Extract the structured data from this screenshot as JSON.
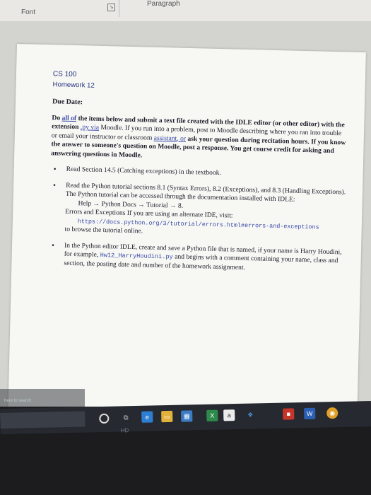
{
  "ribbon": {
    "font_group": "Font",
    "paragraph_group": "Paragraph"
  },
  "doc": {
    "course": "CS 100",
    "homework": "Homework 12",
    "due_label": "Due Date:",
    "intro": {
      "p1": "Do ",
      "p1_link": "all of",
      "p2": " the items below and ",
      "p2_bold": "submit",
      "p3": " a text file created with the IDLE editor (or other editor) with the extension ",
      "p3_ext": ".py via",
      "p4": " Moodle. If you run into a problem, post to Moodle describing where you ran into trouble or email your instructor or classroom ",
      "p4_link": "assistant, or",
      "p5": " ask your question during recitation hours. If you know the answer to someone's question on Moodle, post a response. You get course credit for asking and answering questions in Moodle."
    },
    "bullets": {
      "b1": "Read Section 14.5 (Catching exceptions) in the textbook.",
      "b2_main": "Read the Python tutorial sections 8.1 (Syntax Errors), 8.2 (Exceptions), and 8.3 (Handling Exceptions). The Python tutorial can be accessed through the documentation installed with IDLE:",
      "b2_path": "Help → Python Docs → Tutorial → 8.",
      "b2_alt": "Errors and Exceptions If you are using an alternate IDE, visit:",
      "b2_url": "https://docs.python.org/3/tutorial/errors.html#errors-and-exceptions",
      "b2_end": "to browse the tutorial online.",
      "b3_a": "In the Python editor IDLE, create and save a Python file that is named, if your name is Harry Houdini, for example, ",
      "b3_file": "Hw12_HarryHoudini.py",
      "b3_b": " and begins with a comment containing your name, class and section, the posting date and number of the homework assignment."
    }
  },
  "taskbar": {
    "search_placeholder": "here to search",
    "icon_a": "a",
    "icon_w": "W",
    "fade_label": "HD"
  }
}
